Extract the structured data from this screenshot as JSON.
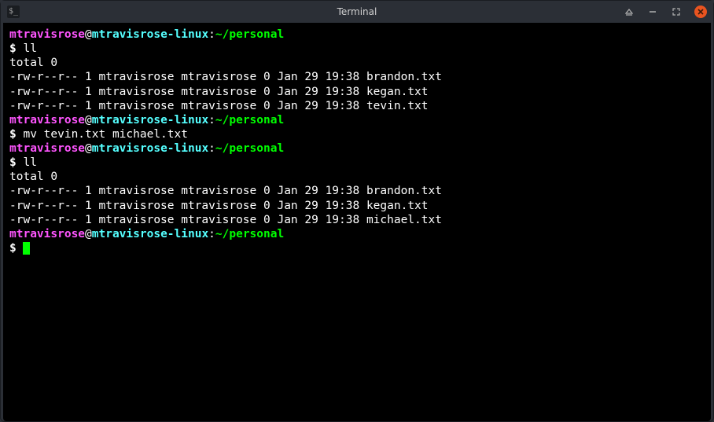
{
  "window": {
    "title": "Terminal",
    "app_icon_text": "$_"
  },
  "prompt": {
    "user": "mtravisrose",
    "at": "@",
    "host": "mtravisrose-linux",
    "colon": ":",
    "path": "~/personal",
    "symbol": "$"
  },
  "session": [
    {
      "type": "prompt"
    },
    {
      "type": "cmd",
      "text": "$ ll"
    },
    {
      "type": "out",
      "text": "total 0"
    },
    {
      "type": "out",
      "text": "-rw-r--r-- 1 mtravisrose mtravisrose 0 Jan 29 19:38 brandon.txt"
    },
    {
      "type": "out",
      "text": "-rw-r--r-- 1 mtravisrose mtravisrose 0 Jan 29 19:38 kegan.txt"
    },
    {
      "type": "out",
      "text": "-rw-r--r-- 1 mtravisrose mtravisrose 0 Jan 29 19:38 tevin.txt"
    },
    {
      "type": "prompt"
    },
    {
      "type": "cmd",
      "text": "$ mv tevin.txt michael.txt"
    },
    {
      "type": "prompt"
    },
    {
      "type": "cmd",
      "text": "$ ll"
    },
    {
      "type": "out",
      "text": "total 0"
    },
    {
      "type": "out",
      "text": "-rw-r--r-- 1 mtravisrose mtravisrose 0 Jan 29 19:38 brandon.txt"
    },
    {
      "type": "out",
      "text": "-rw-r--r-- 1 mtravisrose mtravisrose 0 Jan 29 19:38 kegan.txt"
    },
    {
      "type": "out",
      "text": "-rw-r--r-- 1 mtravisrose mtravisrose 0 Jan 29 19:38 michael.txt"
    },
    {
      "type": "prompt"
    },
    {
      "type": "cursor"
    }
  ]
}
